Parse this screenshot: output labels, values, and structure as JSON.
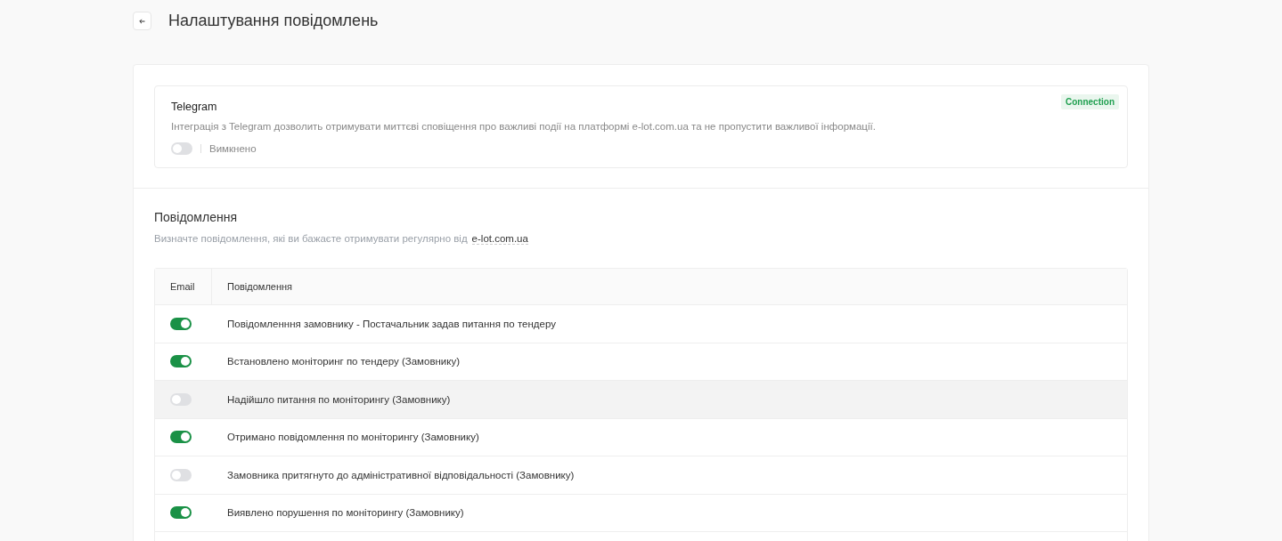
{
  "header": {
    "title": "Налаштування повідомлень"
  },
  "telegram": {
    "title": "Telegram",
    "badge": "Connection",
    "description": "Інтеграція з Telegram дозволить отримувати миттєві сповіщення про важливі події на платформі e-lot.com.ua та не пропустити важливої інформації.",
    "on": false,
    "status": "Вимкнено"
  },
  "notifications": {
    "title": "Повідомлення",
    "description": "Визначте повідомлення, які ви бажаєте отримувати регулярно від",
    "link": "e-lot.com.ua",
    "columns": [
      "Email",
      "Повідомлення"
    ],
    "rows": [
      {
        "email": true,
        "label": "Повідомленння замовнику - Постачальник задав питання по тендеру",
        "highlighted": false
      },
      {
        "email": true,
        "label": "Встановлено моніторинг по тендеру (Замовнику)",
        "highlighted": false
      },
      {
        "email": false,
        "label": "Надійшло питання по моніторингу (Замовнику)",
        "highlighted": true
      },
      {
        "email": true,
        "label": "Отримано повідомлення по моніторингу (Замовнику)",
        "highlighted": false
      },
      {
        "email": false,
        "label": "Замовника притягнуто до адміністративної відповідальності (Замовнику)",
        "highlighted": false
      },
      {
        "email": true,
        "label": "Виявлено порушення по моніторингу (Замовнику)",
        "highlighted": false
      }
    ]
  }
}
